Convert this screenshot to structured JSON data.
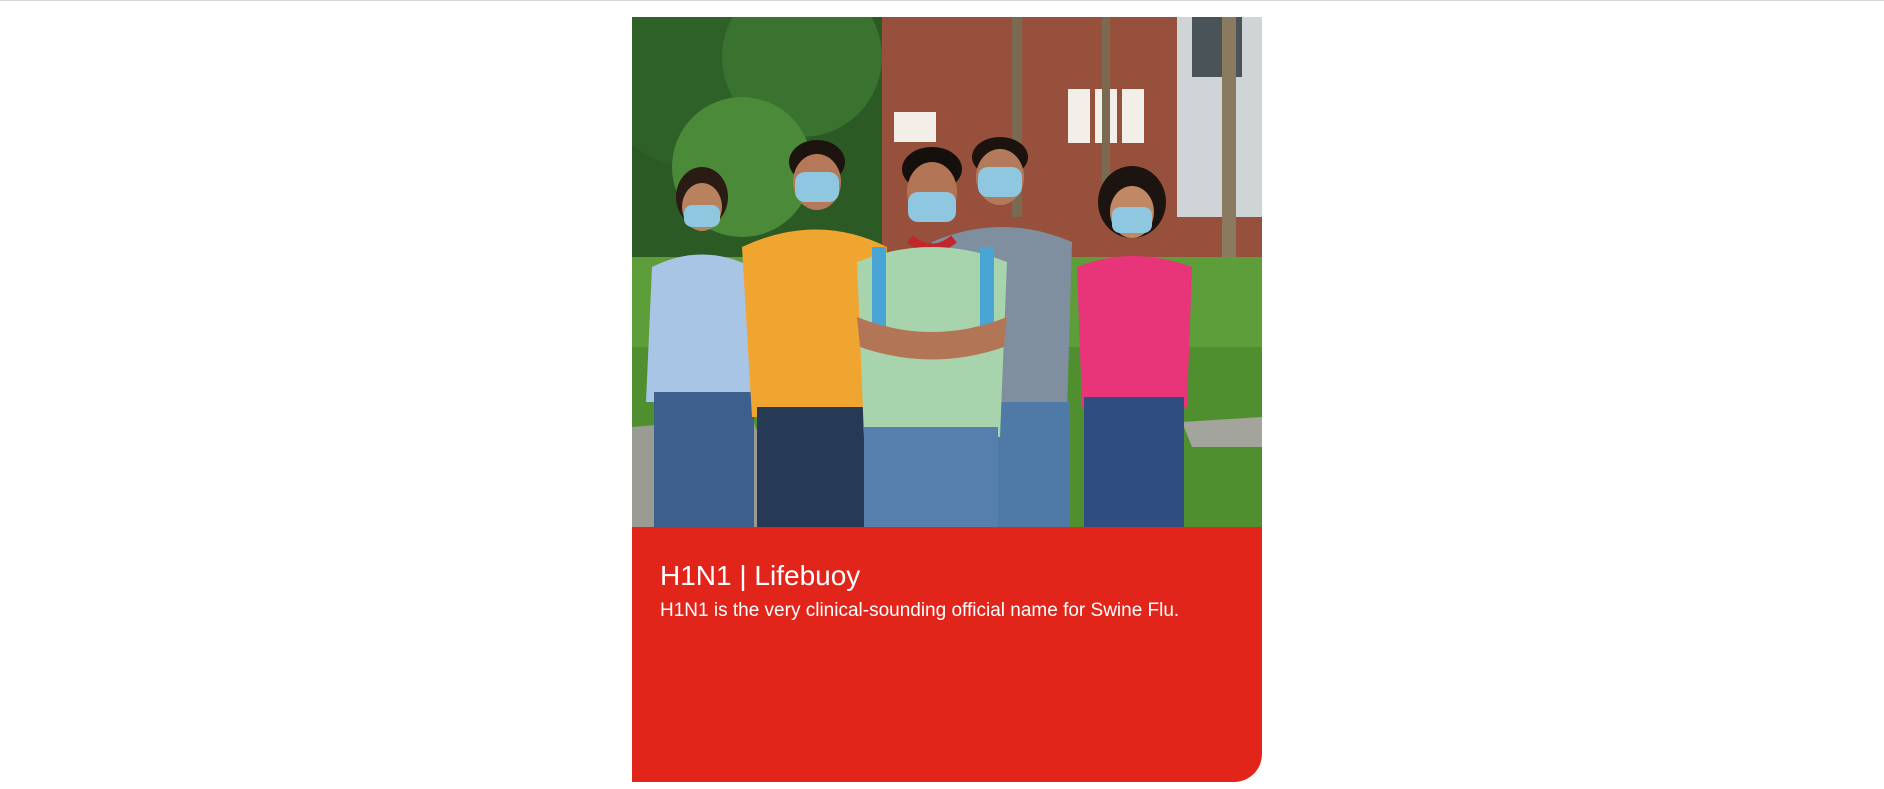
{
  "card": {
    "title": "H1N1 | Lifebuoy",
    "description": "H1N1 is the very clinical-sounding official name for Swine Flu.",
    "image_subject": "group-of-five-young-people-wearing-face-masks-thumbs-up",
    "caption_color": "#e1251b",
    "text_color": "#ffffff"
  }
}
